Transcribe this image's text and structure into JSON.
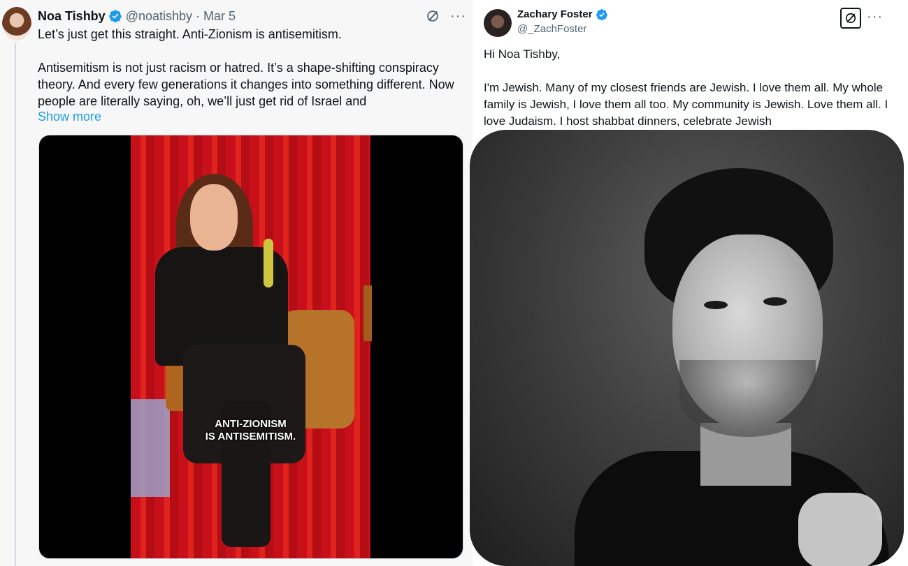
{
  "left_tweet": {
    "author_name": "Noa Tishby",
    "handle": "@noatishby",
    "separator": "·",
    "date": "Mar 5",
    "paragraphs": [
      "Let’s just get this straight. Anti-Zionism is antisemitism.",
      "Antisemitism is not just racism or hatred. It’s a shape-shifting conspiracy theory. And every few generations it changes into something different. Now people are literally saying, oh, we’ll just get rid of Israel and"
    ],
    "show_more": "Show more",
    "video_caption_line1": "ANTI-ZIONISM",
    "video_caption_line2": "IS ANTISEMITISM.",
    "icons": [
      "verified-badge-icon",
      "grok-icon",
      "more-icon"
    ]
  },
  "right_tweet": {
    "author_name": "Zachary Foster",
    "handle": "@_ZachFoster",
    "paragraphs": [
      "Hi Noa Tishby,",
      "I'm Jewish. Many of my closest friends are Jewish. I love them all. My whole family is Jewish, I love them all too. My community is Jewish. Love them all. I love Judaism. I host shabbat dinners, celebrate Jewish"
    ],
    "icons": [
      "verified-badge-icon",
      "grok-icon",
      "more-icon"
    ]
  },
  "colors": {
    "link_blue": "#1d9bf0",
    "text": "#0f1419",
    "muted": "#536471",
    "verified_blue": "#1d9bf0"
  }
}
